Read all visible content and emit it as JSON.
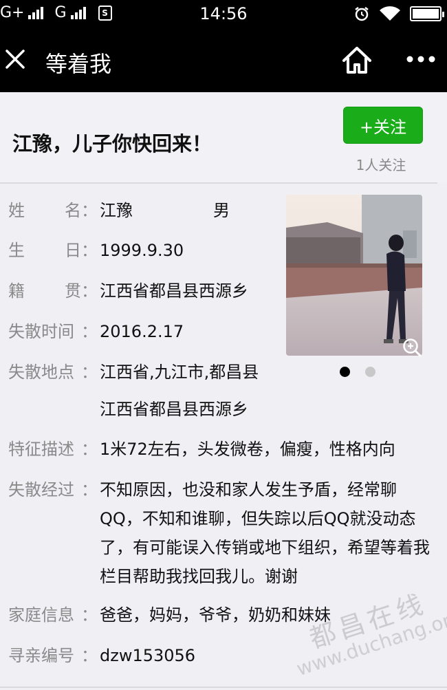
{
  "status_bar": {
    "network_1": "G+",
    "network_2": "G",
    "time": "14:56"
  },
  "nav": {
    "title": "等着我"
  },
  "post": {
    "title": "江豫，儿子你快回来！",
    "follow_label": "+关注",
    "follow_count": "1人关注"
  },
  "info": {
    "name_label_1": "姓",
    "name_label_2": "名",
    "name": "江豫",
    "gender": "男",
    "birthday_label_1": "生",
    "birthday_label_2": "日",
    "birthday": "1999.9.30",
    "origin_label_1": "籍",
    "origin_label_2": "贯",
    "origin": "江西省都昌县西源乡",
    "lost_time_label": "失散时间",
    "lost_time": "2016.2.17",
    "lost_place_label": "失散地点",
    "lost_place_1": "江西省,九江市,都昌县",
    "lost_place_2": "江西省都昌县西源乡",
    "features_label": "特征描述",
    "features": "1米72左右，头发微卷，偏瘦，性格内向",
    "story_label": "失散经过",
    "story": "不知原因，也没和家人发生予盾，经常聊QQ，不知和谁聊，但失踪以后QQ就没动态了，有可能误入传销或地下组织，希望等着我栏目帮助我找回我儿。谢谢",
    "family_label": "家庭信息",
    "family": "爸爸，妈妈，爷爷，奶奶和妹妹",
    "id_label": "寻亲编号",
    "id": "dzw153056",
    "colon": "："
  },
  "photo": {
    "page_count": 2,
    "active_page": 1
  },
  "watermark": {
    "line_1": "都昌在线",
    "line_2": "www.duchang.org"
  },
  "colors": {
    "follow_green": "#1aad19",
    "label_gray": "#8a8a8a",
    "bar_black": "#000000"
  }
}
